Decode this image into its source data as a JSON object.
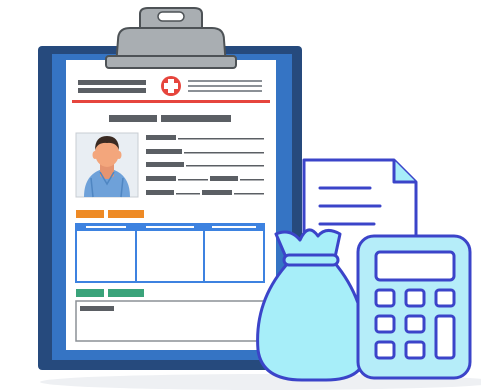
{
  "illustration": {
    "icons": [
      "clipboard-icon",
      "medical-cross-icon",
      "patient-avatar-icon",
      "document-icon",
      "money-bag-icon",
      "calculator-icon"
    ]
  },
  "colors": {
    "board_dark": "#264a7d",
    "board_light": "#3574c4",
    "paper": "#ffffff",
    "clip_gray": "#a9aeb2",
    "clip_dark": "#4d5256",
    "cross_red": "#e6453d",
    "orange_tag": "#ee8a25",
    "green_tag": "#3aa37a",
    "table_blue": "#3d82e0",
    "accent_outline": "#3b44c9",
    "bag_fill": "#a7eef9",
    "calc_fill": "#b5edf9",
    "avatar_bg": "#e9eef3",
    "avatar_shirt": "#6ea1d9",
    "avatar_skin": "#f3a67c",
    "avatar_hair": "#3a2a22",
    "text_placeholder": "#5b5f64"
  }
}
